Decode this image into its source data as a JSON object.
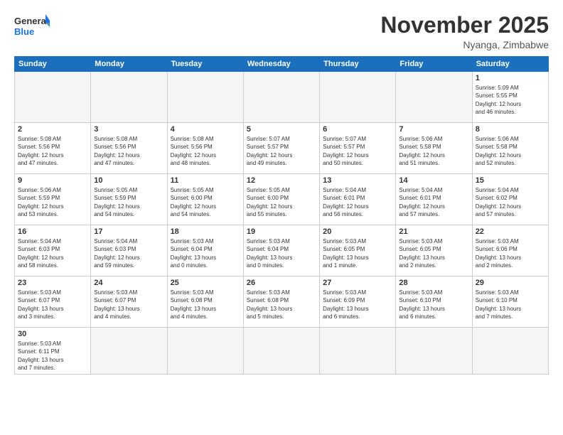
{
  "header": {
    "logo_general": "General",
    "logo_blue": "Blue",
    "month_title": "November 2025",
    "location": "Nyanga, Zimbabwe"
  },
  "days_of_week": [
    "Sunday",
    "Monday",
    "Tuesday",
    "Wednesday",
    "Thursday",
    "Friday",
    "Saturday"
  ],
  "weeks": [
    [
      {
        "num": "",
        "info": ""
      },
      {
        "num": "",
        "info": ""
      },
      {
        "num": "",
        "info": ""
      },
      {
        "num": "",
        "info": ""
      },
      {
        "num": "",
        "info": ""
      },
      {
        "num": "",
        "info": ""
      },
      {
        "num": "1",
        "info": "Sunrise: 5:09 AM\nSunset: 5:55 PM\nDaylight: 12 hours\nand 46 minutes."
      }
    ],
    [
      {
        "num": "2",
        "info": "Sunrise: 5:08 AM\nSunset: 5:56 PM\nDaylight: 12 hours\nand 47 minutes."
      },
      {
        "num": "3",
        "info": "Sunrise: 5:08 AM\nSunset: 5:56 PM\nDaylight: 12 hours\nand 47 minutes."
      },
      {
        "num": "4",
        "info": "Sunrise: 5:08 AM\nSunset: 5:56 PM\nDaylight: 12 hours\nand 48 minutes."
      },
      {
        "num": "5",
        "info": "Sunrise: 5:07 AM\nSunset: 5:57 PM\nDaylight: 12 hours\nand 49 minutes."
      },
      {
        "num": "6",
        "info": "Sunrise: 5:07 AM\nSunset: 5:57 PM\nDaylight: 12 hours\nand 50 minutes."
      },
      {
        "num": "7",
        "info": "Sunrise: 5:06 AM\nSunset: 5:58 PM\nDaylight: 12 hours\nand 51 minutes."
      },
      {
        "num": "8",
        "info": "Sunrise: 5:06 AM\nSunset: 5:58 PM\nDaylight: 12 hours\nand 52 minutes."
      }
    ],
    [
      {
        "num": "9",
        "info": "Sunrise: 5:06 AM\nSunset: 5:59 PM\nDaylight: 12 hours\nand 53 minutes."
      },
      {
        "num": "10",
        "info": "Sunrise: 5:05 AM\nSunset: 5:59 PM\nDaylight: 12 hours\nand 54 minutes."
      },
      {
        "num": "11",
        "info": "Sunrise: 5:05 AM\nSunset: 6:00 PM\nDaylight: 12 hours\nand 54 minutes."
      },
      {
        "num": "12",
        "info": "Sunrise: 5:05 AM\nSunset: 6:00 PM\nDaylight: 12 hours\nand 55 minutes."
      },
      {
        "num": "13",
        "info": "Sunrise: 5:04 AM\nSunset: 6:01 PM\nDaylight: 12 hours\nand 56 minutes."
      },
      {
        "num": "14",
        "info": "Sunrise: 5:04 AM\nSunset: 6:01 PM\nDaylight: 12 hours\nand 57 minutes."
      },
      {
        "num": "15",
        "info": "Sunrise: 5:04 AM\nSunset: 6:02 PM\nDaylight: 12 hours\nand 57 minutes."
      }
    ],
    [
      {
        "num": "16",
        "info": "Sunrise: 5:04 AM\nSunset: 6:03 PM\nDaylight: 12 hours\nand 58 minutes."
      },
      {
        "num": "17",
        "info": "Sunrise: 5:04 AM\nSunset: 6:03 PM\nDaylight: 12 hours\nand 59 minutes."
      },
      {
        "num": "18",
        "info": "Sunrise: 5:03 AM\nSunset: 6:04 PM\nDaylight: 13 hours\nand 0 minutes."
      },
      {
        "num": "19",
        "info": "Sunrise: 5:03 AM\nSunset: 6:04 PM\nDaylight: 13 hours\nand 0 minutes."
      },
      {
        "num": "20",
        "info": "Sunrise: 5:03 AM\nSunset: 6:05 PM\nDaylight: 13 hours\nand 1 minute."
      },
      {
        "num": "21",
        "info": "Sunrise: 5:03 AM\nSunset: 6:05 PM\nDaylight: 13 hours\nand 2 minutes."
      },
      {
        "num": "22",
        "info": "Sunrise: 5:03 AM\nSunset: 6:06 PM\nDaylight: 13 hours\nand 2 minutes."
      }
    ],
    [
      {
        "num": "23",
        "info": "Sunrise: 5:03 AM\nSunset: 6:07 PM\nDaylight: 13 hours\nand 3 minutes."
      },
      {
        "num": "24",
        "info": "Sunrise: 5:03 AM\nSunset: 6:07 PM\nDaylight: 13 hours\nand 4 minutes."
      },
      {
        "num": "25",
        "info": "Sunrise: 5:03 AM\nSunset: 6:08 PM\nDaylight: 13 hours\nand 4 minutes."
      },
      {
        "num": "26",
        "info": "Sunrise: 5:03 AM\nSunset: 6:08 PM\nDaylight: 13 hours\nand 5 minutes."
      },
      {
        "num": "27",
        "info": "Sunrise: 5:03 AM\nSunset: 6:09 PM\nDaylight: 13 hours\nand 6 minutes."
      },
      {
        "num": "28",
        "info": "Sunrise: 5:03 AM\nSunset: 6:10 PM\nDaylight: 13 hours\nand 6 minutes."
      },
      {
        "num": "29",
        "info": "Sunrise: 5:03 AM\nSunset: 6:10 PM\nDaylight: 13 hours\nand 7 minutes."
      }
    ],
    [
      {
        "num": "30",
        "info": "Sunrise: 5:03 AM\nSunset: 6:11 PM\nDaylight: 13 hours\nand 7 minutes."
      },
      {
        "num": "",
        "info": ""
      },
      {
        "num": "",
        "info": ""
      },
      {
        "num": "",
        "info": ""
      },
      {
        "num": "",
        "info": ""
      },
      {
        "num": "",
        "info": ""
      },
      {
        "num": "",
        "info": ""
      }
    ]
  ]
}
